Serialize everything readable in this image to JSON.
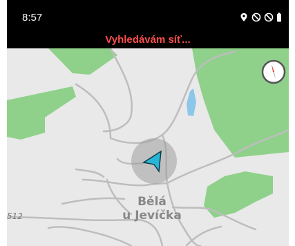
{
  "status_bar": {
    "time": "8:57",
    "icons": [
      "location-icon",
      "blocked-circle-icon",
      "blocked-circle-icon",
      "battery-icon"
    ]
  },
  "banner": {
    "text": "Vyhledávám síť...",
    "color": "#ff4d4d"
  },
  "map": {
    "place_label_line1": "Bělá",
    "place_label_line2": "u Jevíčka",
    "road_label": "512",
    "colors": {
      "background": "#e9e9e9",
      "forest": "#8fd18a",
      "road": "#bdbdbd",
      "water": "#8cc6e8",
      "marker": "#29b6d6"
    }
  },
  "compass": {
    "icon": "compass-icon",
    "needle_color": "#e53935"
  }
}
